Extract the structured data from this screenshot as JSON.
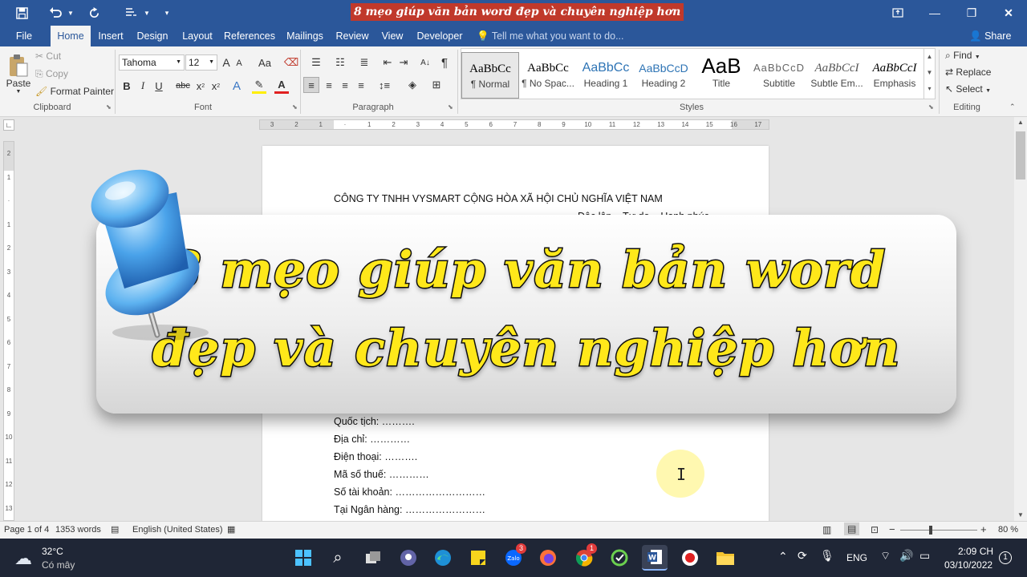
{
  "titlebar": {
    "doc_title": "8 mẹo giúp văn bản word đẹp và chuyên nghiệp hơn",
    "save_icon": "save-icon",
    "undo_icon": "undo-icon",
    "redo_icon": "redo-icon",
    "touch_mode_icon": "touch-mode-icon",
    "customize_icon": "customize-qat-icon",
    "minimize": "—",
    "restore": "❐",
    "close": "✕",
    "ribbon_options": "⇪"
  },
  "tabs": [
    "File",
    "Home",
    "Insert",
    "Design",
    "Layout",
    "References",
    "Mailings",
    "Review",
    "View",
    "Developer"
  ],
  "tell_me": "Tell me what you want to do...",
  "share": "Share",
  "clipboard": {
    "paste": "Paste",
    "cut": "Cut",
    "copy": "Copy",
    "format_painter": "Format Painter",
    "label": "Clipboard"
  },
  "font": {
    "name": "Tahoma",
    "size": "12",
    "grow": "A",
    "shrink": "A",
    "change_case": "Aa",
    "bold": "B",
    "italic": "I",
    "underline": "U",
    "strike": "abc",
    "subscript": "x",
    "superscript": "x",
    "label": "Font"
  },
  "paragraph": {
    "label": "Paragraph",
    "sort": "A↓",
    "pilcrow": "¶"
  },
  "styles": {
    "label": "Styles",
    "items": [
      {
        "preview": "AaBbCc",
        "name": "¶ Normal"
      },
      {
        "preview": "AaBbCc",
        "name": "¶ No Spac..."
      },
      {
        "preview": "AaBbCc",
        "name": "Heading 1"
      },
      {
        "preview": "AaBbCcD",
        "name": "Heading 2"
      },
      {
        "preview": "AaB",
        "name": "Title"
      },
      {
        "preview": "AaBbCcD",
        "name": "Subtitle"
      },
      {
        "preview": "AaBbCcI",
        "name": "Subtle Em..."
      },
      {
        "preview": "AaBbCcI",
        "name": "Emphasis"
      }
    ],
    "accent_heading": "#2e74b5"
  },
  "editing": {
    "find": "Find",
    "replace": "Replace",
    "select": "Select",
    "label": "Editing"
  },
  "ruler_ticks": [
    "3",
    "2",
    "1",
    "",
    "1",
    "2",
    "3",
    "4",
    "5",
    "6",
    "7",
    "8",
    "9",
    "10",
    "11",
    "12",
    "13",
    "14",
    "15",
    "16",
    "17"
  ],
  "vruler_ticks": [
    "2",
    "1",
    "",
    "1",
    "2",
    "3",
    "4",
    "5",
    "6",
    "7",
    "8",
    "9",
    "10",
    "11",
    "12",
    "13"
  ],
  "document": {
    "header_line": "CÔNG TY TNHH VYSMART CỘNG HÒA XÃ HỘI CHỦ NGHĨA VIỆT NAM",
    "motto": "Độc lập – Tự do – Hạnh phúc",
    "lines": [
      "Quốc tịch: ……….",
      "Địa chỉ: …………",
      "Điện thoại: ……….",
      "Mã số thuế: …………",
      "Số tài khoản: ………………………",
      "Tại Ngân hàng: ……………………"
    ]
  },
  "banner": {
    "line1": "8 mẹo giúp văn bản word",
    "line2": "đẹp và chuyên nghiệp hơn",
    "text_color": "#ffe81a"
  },
  "status": {
    "page": "Page 1 of 4",
    "words": "1353 words",
    "language": "English (United States)",
    "zoom": "80 %",
    "zoom_minus": "−",
    "zoom_plus": "+"
  },
  "taskbar": {
    "weather_temp": "32°C",
    "weather_desc": "Có mây",
    "time": "2:09 CH",
    "date": "03/10/2022",
    "lang": "ENG",
    "zalo_badge": "3",
    "chrome_badge": "1",
    "notif_count": "1"
  }
}
